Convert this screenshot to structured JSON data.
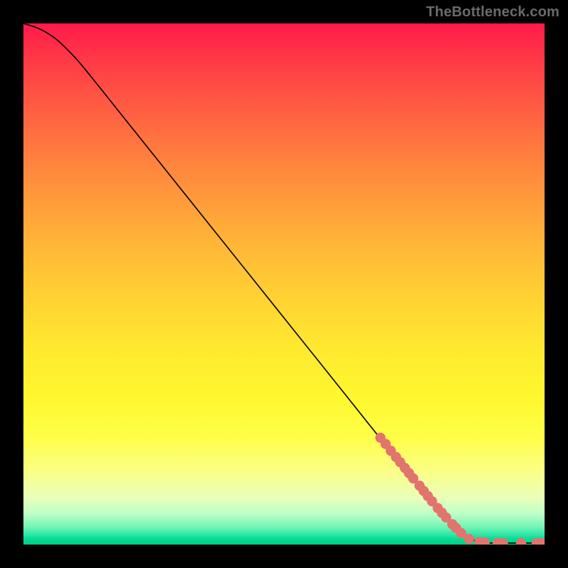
{
  "attribution": "TheBottleneck.com",
  "chart_data": {
    "type": "line",
    "title": "",
    "xlabel": "",
    "ylabel": "",
    "xlim": [
      0,
      100
    ],
    "ylim": [
      0,
      100
    ],
    "curve": [
      {
        "x": 0.0,
        "y": 100.0
      },
      {
        "x": 3.0,
        "y": 99.0
      },
      {
        "x": 6.0,
        "y": 97.2
      },
      {
        "x": 9.0,
        "y": 94.4
      },
      {
        "x": 12.0,
        "y": 91.0
      },
      {
        "x": 20.0,
        "y": 81.0
      },
      {
        "x": 30.0,
        "y": 68.5
      },
      {
        "x": 40.0,
        "y": 56.0
      },
      {
        "x": 50.0,
        "y": 43.5
      },
      {
        "x": 60.0,
        "y": 31.0
      },
      {
        "x": 70.0,
        "y": 18.5
      },
      {
        "x": 80.0,
        "y": 6.5
      },
      {
        "x": 84.0,
        "y": 2.2
      },
      {
        "x": 86.5,
        "y": 0.8
      },
      {
        "x": 88.0,
        "y": 0.4
      },
      {
        "x": 90.0,
        "y": 0.3
      },
      {
        "x": 95.0,
        "y": 0.3
      },
      {
        "x": 100.0,
        "y": 0.3
      }
    ],
    "markers": [
      {
        "x": 68.5,
        "y": 20.5
      },
      {
        "x": 69.5,
        "y": 19.3
      },
      {
        "x": 70.5,
        "y": 18.0
      },
      {
        "x": 71.5,
        "y": 16.8
      },
      {
        "x": 72.3,
        "y": 15.8
      },
      {
        "x": 73.2,
        "y": 14.7
      },
      {
        "x": 74.0,
        "y": 13.7
      },
      {
        "x": 74.8,
        "y": 12.7
      },
      {
        "x": 76.0,
        "y": 11.3
      },
      {
        "x": 76.8,
        "y": 10.3
      },
      {
        "x": 77.6,
        "y": 9.3
      },
      {
        "x": 78.4,
        "y": 8.3
      },
      {
        "x": 79.5,
        "y": 7.0
      },
      {
        "x": 80.3,
        "y": 6.1
      },
      {
        "x": 81.1,
        "y": 5.2
      },
      {
        "x": 82.3,
        "y": 3.9
      },
      {
        "x": 83.0,
        "y": 3.2
      },
      {
        "x": 84.0,
        "y": 2.2
      },
      {
        "x": 85.5,
        "y": 1.1
      },
      {
        "x": 87.5,
        "y": 0.5
      },
      {
        "x": 88.5,
        "y": 0.4
      },
      {
        "x": 91.0,
        "y": 0.3
      },
      {
        "x": 92.0,
        "y": 0.3
      },
      {
        "x": 95.5,
        "y": 0.3
      },
      {
        "x": 98.5,
        "y": 0.3
      },
      {
        "x": 99.5,
        "y": 0.3
      }
    ],
    "marker_color": "#e2746e",
    "curve_color": "#000000"
  }
}
